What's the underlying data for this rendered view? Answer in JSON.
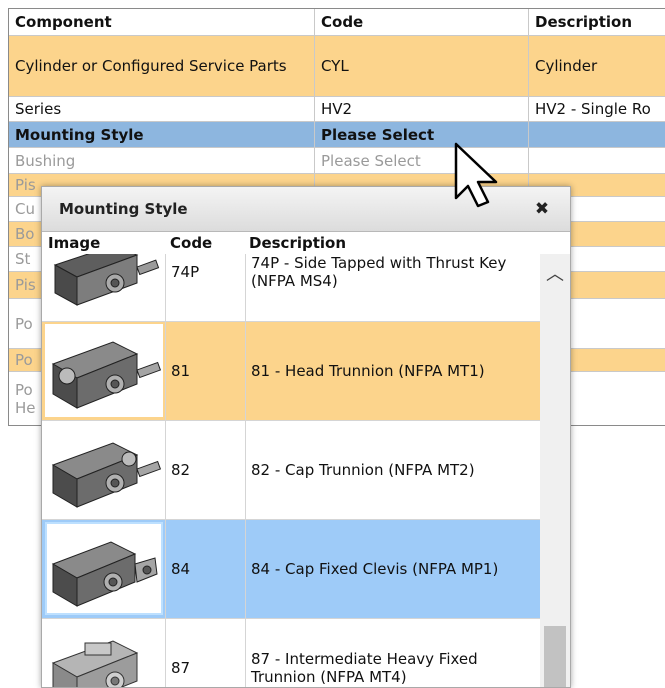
{
  "table": {
    "headers": [
      "Component",
      "Code",
      "Description"
    ],
    "rows": [
      {
        "component": "Cylinder or Configured Service Parts",
        "code": "CYL",
        "description": "Cylinder"
      },
      {
        "component": "Series",
        "code": "HV2",
        "description": "HV2 - Single Ro"
      },
      {
        "component": "Mounting Style",
        "code": "Please Select",
        "description": ""
      },
      {
        "component": "Bushing",
        "code": "Please Select",
        "description": ""
      },
      {
        "component": "Pis",
        "code": "",
        "description": ""
      },
      {
        "component": "Cu",
        "code": "",
        "description": ""
      },
      {
        "component": "Bo",
        "code": "",
        "description": ""
      },
      {
        "component": "St",
        "code": "",
        "description": ""
      },
      {
        "component": "Pis",
        "code": "",
        "description": ""
      },
      {
        "component": "Po",
        "code": "",
        "description": ""
      },
      {
        "component": "Po",
        "code": "",
        "description": ""
      },
      {
        "component": "Po\nHe",
        "code": "",
        "description": ""
      }
    ]
  },
  "modal": {
    "title": "Mounting Style",
    "close_icon": "close-icon",
    "headers": {
      "image": "Image",
      "code": "Code",
      "description": "Description"
    },
    "items": [
      {
        "code": "74P",
        "description": "74P - Side Tapped with Thrust Key (NFPA MS4)",
        "state": "normal"
      },
      {
        "code": "81",
        "description": "81 - Head Trunnion (NFPA MT1)",
        "state": "hover"
      },
      {
        "code": "82",
        "description": "82 - Cap Trunnion (NFPA MT2)",
        "state": "normal"
      },
      {
        "code": "84",
        "description": "84 - Cap Fixed Clevis (NFPA MP1)",
        "state": "selected"
      },
      {
        "code": "87",
        "description": "87 - Intermediate Heavy Fixed Trunnion (NFPA MT4)",
        "state": "normal"
      }
    ]
  },
  "colors": {
    "orange_row": "#fcd48c",
    "blue_row": "#8db6df",
    "selected_item": "#9ecbf8"
  }
}
